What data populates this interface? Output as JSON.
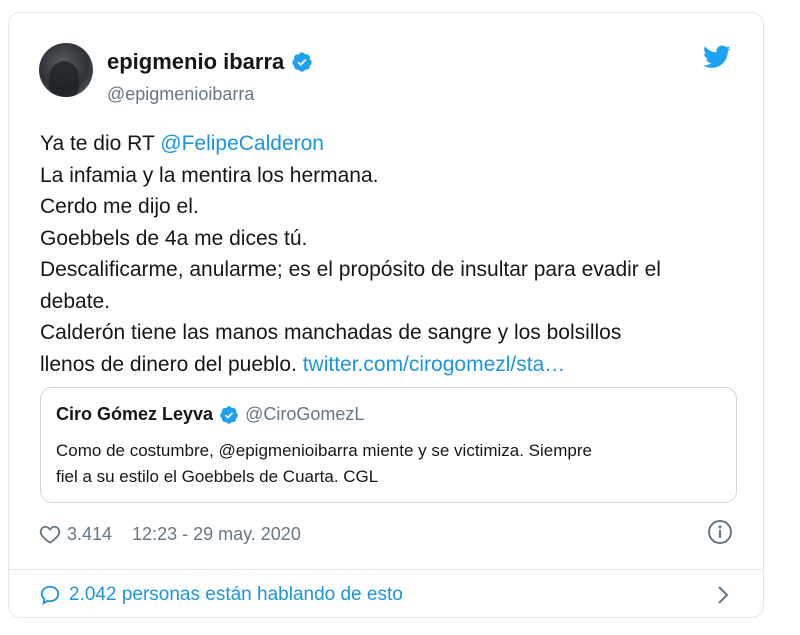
{
  "tweet": {
    "author": {
      "name": "epigmenio ibarra",
      "handle": "@epigmenioibarra"
    },
    "body": {
      "line1_prefix": "Ya te dio RT ",
      "line1_mention": "@FelipeCalderon",
      "line2": "La infamia y la mentira los hermana.",
      "line3": "Cerdo me dijo el.",
      "line4": "Goebbels de 4a me dices tú.",
      "line5": "Descalificarme, anularme; es el propósito de insultar para evadir el",
      "line6": "debate.",
      "line7": "Calderón tiene las manos manchadas de sangre y los bolsillos",
      "line8_prefix": "llenos de dinero del pueblo. ",
      "line8_link": "twitter.com/cirogomezl/sta…"
    },
    "quote": {
      "name": "Ciro Gómez Leyva",
      "handle": "@CiroGomezL",
      "line1": "Como de costumbre, @epigmenioibarra miente y se victimiza. Siempre",
      "line2": "fiel a su estilo el Goebbels de Cuarta. CGL"
    },
    "likes": "3.414",
    "timestamp": "12:23 - 29 may. 2020",
    "conversation": "2.042 personas están hablando de esto"
  },
  "colors": {
    "link": "#1b95e0",
    "secondary_text": "#657786",
    "border": "#e1e8ed",
    "verified": "#1da1f2"
  },
  "icons": [
    "verified-badge-icon",
    "twitter-bird-icon",
    "heart-icon",
    "info-icon",
    "speech-bubble-icon",
    "chevron-right-icon"
  ]
}
